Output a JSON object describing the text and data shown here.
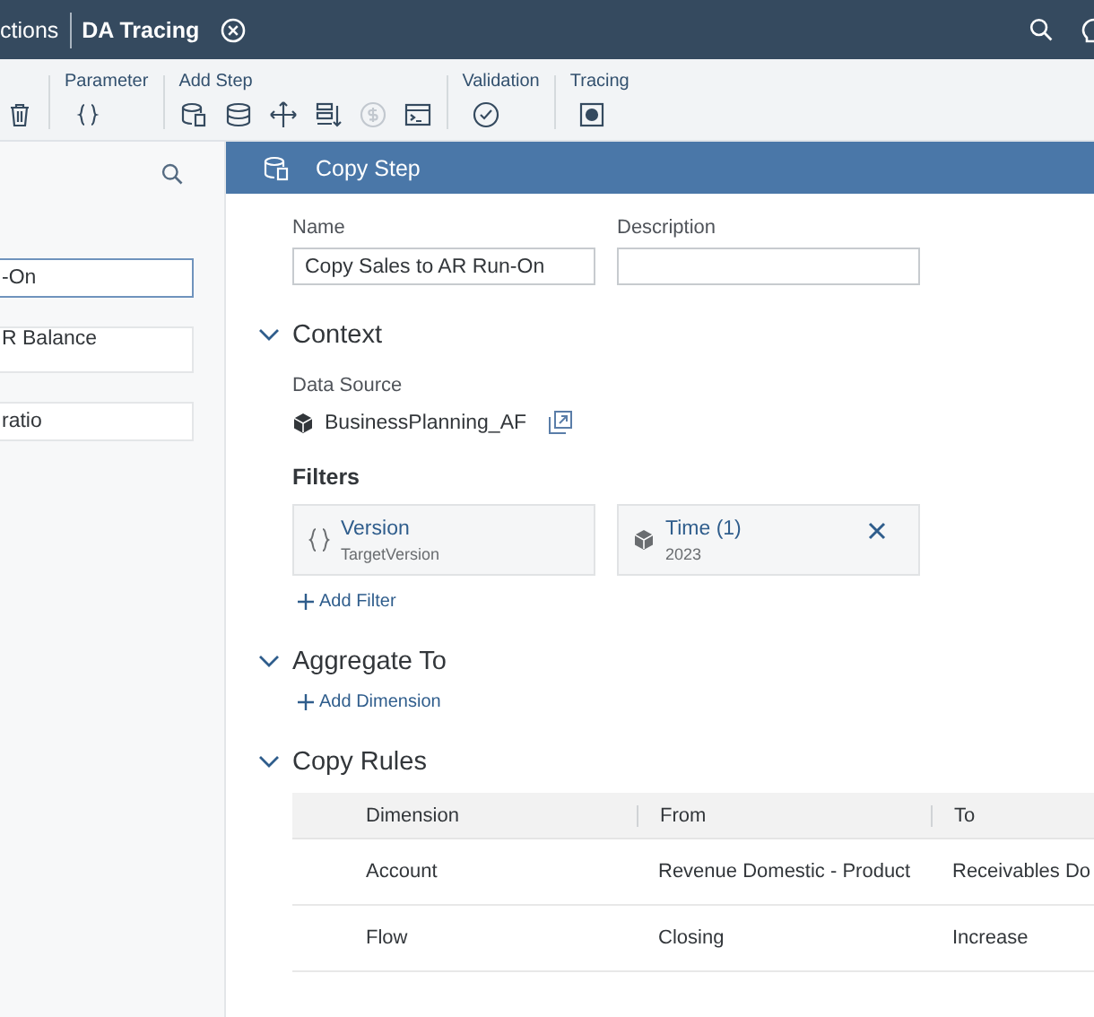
{
  "shell": {
    "tabs": [
      {
        "label": "ctions",
        "selected": false
      },
      {
        "label": "DA Tracing",
        "selected": true
      }
    ]
  },
  "toolbar": {
    "groups": [
      {
        "tools": [
          {
            "disabled": false
          }
        ]
      },
      {
        "label": "Parameter",
        "tools": [
          {
            "disabled": false
          }
        ]
      },
      {
        "label": "Add Step",
        "tools": [
          {
            "disabled": false
          },
          {
            "disabled": false
          },
          {
            "disabled": false
          },
          {
            "disabled": false
          },
          {
            "disabled": true
          },
          {
            "disabled": false
          }
        ]
      },
      {
        "label": "Validation",
        "tools": [
          {
            "disabled": false
          }
        ]
      },
      {
        "label": "Tracing",
        "tools": [
          {
            "disabled": false
          }
        ]
      }
    ]
  },
  "sidebar": {
    "items": [
      {
        "text": "-On",
        "selected": true
      },
      {
        "text": "R Balance",
        "selected": false
      },
      {
        "text": "ratio",
        "selected": false
      }
    ]
  },
  "step": {
    "title": "Copy Step",
    "name": {
      "label": "Name",
      "value": "Copy Sales to AR Run-On"
    },
    "description": {
      "label": "Description"
    },
    "context": {
      "title": "Context",
      "expanded": true,
      "data_source_label": "Data Source",
      "data_source": "BusinessPlanning_AF",
      "filters_title": "Filters",
      "filters": [
        {
          "kind": "parameter",
          "title": "Version",
          "subtitle": "TargetVersion",
          "removable": false
        },
        {
          "kind": "dimension",
          "title": "Time (1)",
          "subtitle": "2023",
          "removable": true
        }
      ],
      "add_filter": "Add Filter"
    },
    "aggregate": {
      "title": "Aggregate To",
      "expanded": true,
      "add": "Add Dimension"
    },
    "copy_rules": {
      "title": "Copy Rules",
      "expanded": true,
      "columns": [
        "Dimension",
        "From",
        "To"
      ],
      "rows": [
        [
          "Account",
          "Revenue Domestic - Product",
          "Receivables Do"
        ],
        [
          "Flow",
          "Closing",
          "Increase"
        ]
      ]
    }
  }
}
